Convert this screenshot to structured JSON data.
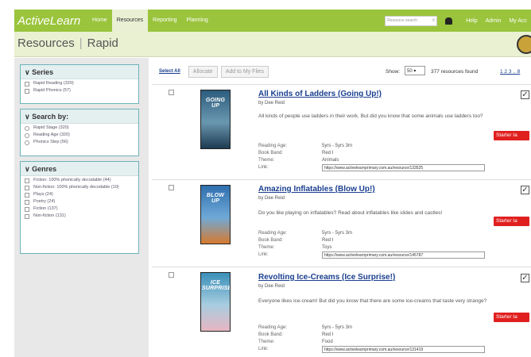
{
  "nav": {
    "logo": "ActiveLearn",
    "tabs": [
      "Home",
      "Resources",
      "Reporting",
      "Planning"
    ],
    "active_tab": "Resources",
    "search_placeholder": "Resource search",
    "links": [
      "Help",
      "Admin",
      "My Acc"
    ]
  },
  "header": {
    "title": "Resources",
    "subtitle": "Rapid"
  },
  "sidebar": {
    "series": {
      "title": "Series",
      "items": [
        "Rapid Reading (320)",
        "Rapid Phonics (57)"
      ]
    },
    "search_by": {
      "title": "Search by:",
      "items": [
        "Rapid Stage (320)",
        "Reading Age (320)",
        "Phonics Step (56)"
      ]
    },
    "genres": {
      "title": "Genres",
      "items": [
        "Fiction: 100% phonically decodable (44)",
        "Non-fiction: 100% phonically decodable (10)",
        "Plays (24)",
        "Poetry (24)",
        "Fiction (137)",
        "Non-fiction (131)"
      ]
    }
  },
  "toolbar": {
    "select_all": "Select All",
    "allocate": "Allocate",
    "add_to_files": "Add to My Files",
    "show_label": "Show:",
    "show_value": "50",
    "results_count": "377 resources found",
    "pages": "1 2 3 .. 8"
  },
  "labels": {
    "reading_age": "Reading Age:",
    "book_band": "Book Band:",
    "theme": "Theme:",
    "link": "Link:",
    "starter": "Starter Ia"
  },
  "results": [
    {
      "title": "All Kinds of Ladders (Going Up!)",
      "cover_title": "GOING UP",
      "author": "by Dee Reid",
      "description": "All kinds of people use ladders in their work. But did you know that some animals use ladders too?",
      "reading_age": "5yrs - 5yrs 3m",
      "book_band": "Red I",
      "theme": "Animals",
      "link": "https://www.activelearnprimary.com.au/resource/133525",
      "cover_colors": [
        "#2d5d7e",
        "#6a97b0",
        "#1e3b52"
      ]
    },
    {
      "title": "Amazing Inflatables (Blow Up!)",
      "cover_title": "BLOW UP",
      "author": "by Dee Reid",
      "description": "Do you like playing on inflatables? Read about inflatables like slides and castles!",
      "reading_age": "5yrs - 5yrs 3m",
      "book_band": "Red I",
      "theme": "Toys",
      "link": "https://www.activelearnprimary.com.au/resource/145787",
      "cover_colors": [
        "#2f6fae",
        "#6fa9d8",
        "#d67a2f"
      ]
    },
    {
      "title": "Revolting Ice-Creams (Ice Surprise!)",
      "cover_title": "ICE SURPRISE",
      "author": "by Dee Reid",
      "description": "Everyone likes ice-cream! But did you know that there are some ice-creams that taste very strange?",
      "reading_age": "5yrs - 5yrs 3m",
      "book_band": "Red I",
      "theme": "Food",
      "link": "https://www.activelearnprimary.com.au/resource/131419",
      "cover_colors": [
        "#3a8fb8",
        "#a8cde0",
        "#e7b6c2"
      ]
    }
  ],
  "colors": {
    "nav_green": "#9ac43c",
    "header_bg": "#e9f1d2",
    "link_blue": "#1a3f8f",
    "starter_red": "#e0201f",
    "panel_border": "#6fb3b9"
  }
}
